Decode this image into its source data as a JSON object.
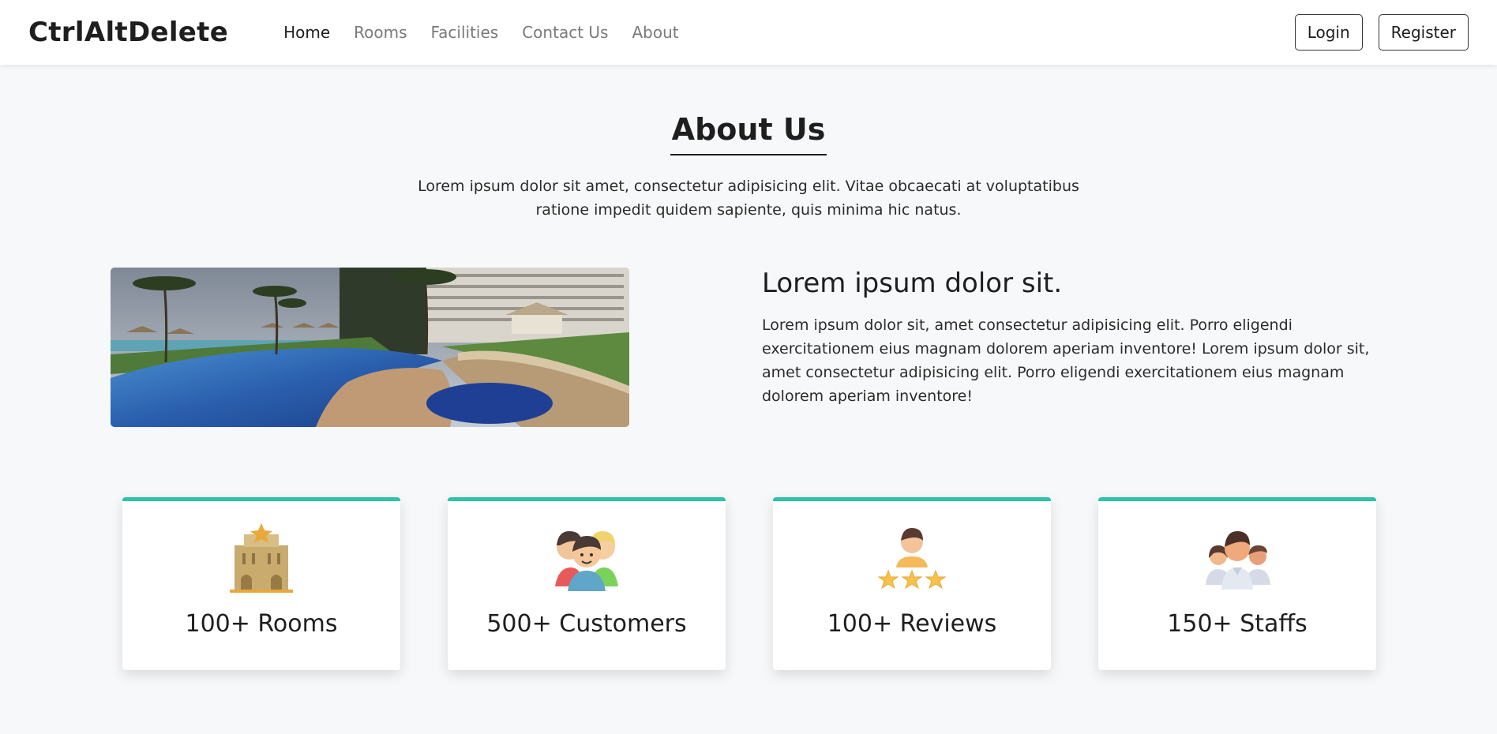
{
  "nav": {
    "brand": "CtrlAltDelete",
    "links": [
      "Home",
      "Rooms",
      "Facilities",
      "Contact Us",
      "About"
    ],
    "login": "Login",
    "register": "Register"
  },
  "about": {
    "title": "About Us",
    "lead": "Lorem ipsum dolor sit amet, consectetur adipisicing elit. Vitae obcaecati at voluptatibus ratione impedit quidem sapiente, quis minima hic natus.",
    "subheading": "Lorem ipsum dolor sit.",
    "paragraph": "Lorem ipsum dolor sit, amet consectetur adipisicing elit. Porro eligendi exercitationem eius magnam dolorem aperiam inventore! Lorem ipsum dolor sit, amet consectetur adipisicing elit. Porro eligendi exercitationem eius magnam dolorem aperiam inventore!"
  },
  "stats": [
    {
      "label": "100+ Rooms",
      "icon": "hotel-icon"
    },
    {
      "label": "500+ Customers",
      "icon": "customers-icon"
    },
    {
      "label": "100+ Reviews",
      "icon": "reviews-icon"
    },
    {
      "label": "150+ Staffs",
      "icon": "staff-icon"
    }
  ],
  "colors": {
    "accent": "#2ec1ac",
    "background": "#f7f8fa"
  }
}
